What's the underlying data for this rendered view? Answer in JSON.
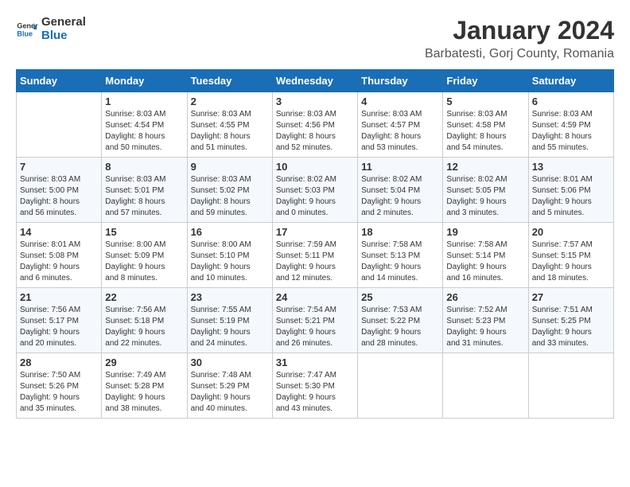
{
  "logo": {
    "general": "General",
    "blue": "Blue"
  },
  "title": "January 2024",
  "subtitle": "Barbatesti, Gorj County, Romania",
  "weekdays": [
    "Sunday",
    "Monday",
    "Tuesday",
    "Wednesday",
    "Thursday",
    "Friday",
    "Saturday"
  ],
  "weeks": [
    [
      {
        "day": "",
        "info": ""
      },
      {
        "day": "1",
        "info": "Sunrise: 8:03 AM\nSunset: 4:54 PM\nDaylight: 8 hours\nand 50 minutes."
      },
      {
        "day": "2",
        "info": "Sunrise: 8:03 AM\nSunset: 4:55 PM\nDaylight: 8 hours\nand 51 minutes."
      },
      {
        "day": "3",
        "info": "Sunrise: 8:03 AM\nSunset: 4:56 PM\nDaylight: 8 hours\nand 52 minutes."
      },
      {
        "day": "4",
        "info": "Sunrise: 8:03 AM\nSunset: 4:57 PM\nDaylight: 8 hours\nand 53 minutes."
      },
      {
        "day": "5",
        "info": "Sunrise: 8:03 AM\nSunset: 4:58 PM\nDaylight: 8 hours\nand 54 minutes."
      },
      {
        "day": "6",
        "info": "Sunrise: 8:03 AM\nSunset: 4:59 PM\nDaylight: 8 hours\nand 55 minutes."
      }
    ],
    [
      {
        "day": "7",
        "info": "Sunrise: 8:03 AM\nSunset: 5:00 PM\nDaylight: 8 hours\nand 56 minutes."
      },
      {
        "day": "8",
        "info": "Sunrise: 8:03 AM\nSunset: 5:01 PM\nDaylight: 8 hours\nand 57 minutes."
      },
      {
        "day": "9",
        "info": "Sunrise: 8:03 AM\nSunset: 5:02 PM\nDaylight: 8 hours\nand 59 minutes."
      },
      {
        "day": "10",
        "info": "Sunrise: 8:02 AM\nSunset: 5:03 PM\nDaylight: 9 hours\nand 0 minutes."
      },
      {
        "day": "11",
        "info": "Sunrise: 8:02 AM\nSunset: 5:04 PM\nDaylight: 9 hours\nand 2 minutes."
      },
      {
        "day": "12",
        "info": "Sunrise: 8:02 AM\nSunset: 5:05 PM\nDaylight: 9 hours\nand 3 minutes."
      },
      {
        "day": "13",
        "info": "Sunrise: 8:01 AM\nSunset: 5:06 PM\nDaylight: 9 hours\nand 5 minutes."
      }
    ],
    [
      {
        "day": "14",
        "info": "Sunrise: 8:01 AM\nSunset: 5:08 PM\nDaylight: 9 hours\nand 6 minutes."
      },
      {
        "day": "15",
        "info": "Sunrise: 8:00 AM\nSunset: 5:09 PM\nDaylight: 9 hours\nand 8 minutes."
      },
      {
        "day": "16",
        "info": "Sunrise: 8:00 AM\nSunset: 5:10 PM\nDaylight: 9 hours\nand 10 minutes."
      },
      {
        "day": "17",
        "info": "Sunrise: 7:59 AM\nSunset: 5:11 PM\nDaylight: 9 hours\nand 12 minutes."
      },
      {
        "day": "18",
        "info": "Sunrise: 7:58 AM\nSunset: 5:13 PM\nDaylight: 9 hours\nand 14 minutes."
      },
      {
        "day": "19",
        "info": "Sunrise: 7:58 AM\nSunset: 5:14 PM\nDaylight: 9 hours\nand 16 minutes."
      },
      {
        "day": "20",
        "info": "Sunrise: 7:57 AM\nSunset: 5:15 PM\nDaylight: 9 hours\nand 18 minutes."
      }
    ],
    [
      {
        "day": "21",
        "info": "Sunrise: 7:56 AM\nSunset: 5:17 PM\nDaylight: 9 hours\nand 20 minutes."
      },
      {
        "day": "22",
        "info": "Sunrise: 7:56 AM\nSunset: 5:18 PM\nDaylight: 9 hours\nand 22 minutes."
      },
      {
        "day": "23",
        "info": "Sunrise: 7:55 AM\nSunset: 5:19 PM\nDaylight: 9 hours\nand 24 minutes."
      },
      {
        "day": "24",
        "info": "Sunrise: 7:54 AM\nSunset: 5:21 PM\nDaylight: 9 hours\nand 26 minutes."
      },
      {
        "day": "25",
        "info": "Sunrise: 7:53 AM\nSunset: 5:22 PM\nDaylight: 9 hours\nand 28 minutes."
      },
      {
        "day": "26",
        "info": "Sunrise: 7:52 AM\nSunset: 5:23 PM\nDaylight: 9 hours\nand 31 minutes."
      },
      {
        "day": "27",
        "info": "Sunrise: 7:51 AM\nSunset: 5:25 PM\nDaylight: 9 hours\nand 33 minutes."
      }
    ],
    [
      {
        "day": "28",
        "info": "Sunrise: 7:50 AM\nSunset: 5:26 PM\nDaylight: 9 hours\nand 35 minutes."
      },
      {
        "day": "29",
        "info": "Sunrise: 7:49 AM\nSunset: 5:28 PM\nDaylight: 9 hours\nand 38 minutes."
      },
      {
        "day": "30",
        "info": "Sunrise: 7:48 AM\nSunset: 5:29 PM\nDaylight: 9 hours\nand 40 minutes."
      },
      {
        "day": "31",
        "info": "Sunrise: 7:47 AM\nSunset: 5:30 PM\nDaylight: 9 hours\nand 43 minutes."
      },
      {
        "day": "",
        "info": ""
      },
      {
        "day": "",
        "info": ""
      },
      {
        "day": "",
        "info": ""
      }
    ]
  ]
}
